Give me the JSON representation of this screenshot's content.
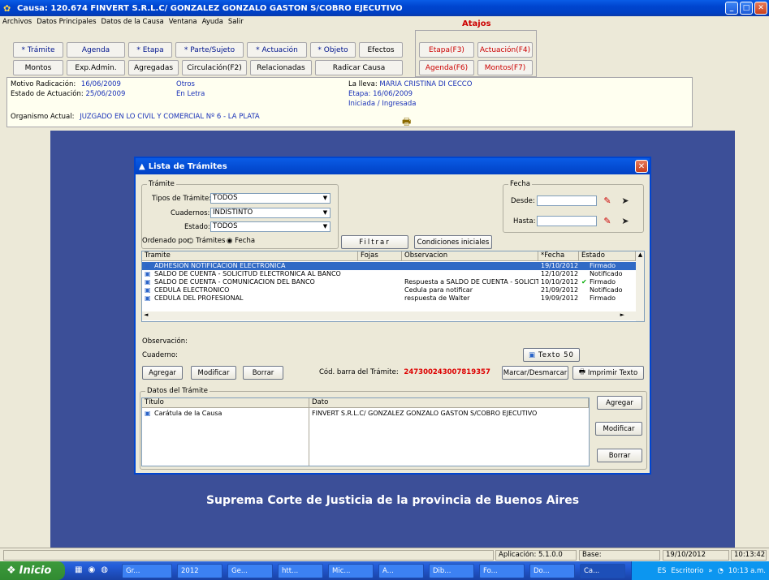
{
  "window": {
    "title": "Causa: 120.674  FINVERT S.R.L.C/ GONZALEZ GONZALO GASTON S/COBRO EJECUTIVO",
    "min": "_",
    "max": "□",
    "close": "✕"
  },
  "menu": [
    "Archivos",
    "Datos Principales",
    "Datos de la Causa",
    "Ventana",
    "Ayuda",
    "Salir"
  ],
  "toolbar": {
    "tramite": "* Trámite",
    "agenda": "Agenda",
    "etapa": "* Etapa",
    "parte": "* Parte/Sujeto",
    "actuacion": "* Actuación",
    "objeto": "* Objeto",
    "efectos": "Efectos",
    "montos": "Montos",
    "expadmin": "Exp.Admin.",
    "agregadas": "Agregadas",
    "circulacion": "Circulación(F2)",
    "relacionadas": "Relacionadas",
    "radicar": "Radicar Causa",
    "atajos_title": "Atajos",
    "etapa_f3": "Etapa(F3)",
    "actuacion_f4": "Actuación(F4)",
    "agenda_f6": "Agenda(F6)",
    "montos_f7": "Montos(F7)"
  },
  "info": {
    "motivo_label": "Motivo Radicación:",
    "motivo_date": "16/06/2009",
    "motivo_value": "Otros",
    "estado_label": "Estado de Actuación:",
    "estado_date": "25/06/2009",
    "estado_value": "En Letra",
    "lleva_label": "La lleva:",
    "lleva_value": "MARIA CRISTINA DI CECCO",
    "etapa": "Etapa: 16/06/2009",
    "iniciada": "Iniciada / Ingresada",
    "organismo_label": "Organismo Actual:",
    "organismo_value": "JUZGADO EN LO CIVIL Y COMERCIAL Nº 6 - LA PLATA"
  },
  "background_caption": "Suprema Corte de Justicia de la provincia de Buenos Aires",
  "dialog": {
    "title": "Lista de Trámites",
    "tramite_group": "Trámite",
    "tipos_label": "Tipos de Trámite:",
    "tipos_value": "TODOS",
    "cuadernos_label": "Cuadernos:",
    "cuadernos_value": "INDISTINTO",
    "estado_label": "Estado:",
    "estado_value": "TODOS",
    "ordenado_label": "Ordenado por:",
    "ord_tramites": "Trámites",
    "ord_fecha": "Fecha",
    "fecha_group": "Fecha",
    "desde_label": "Desde:",
    "hasta_label": "Hasta:",
    "filtrar": "Filtrar",
    "condiciones": "Condiciones iniciales",
    "grid_headers": [
      "Tramite",
      "Fojas",
      "Observacion",
      "*Fecha",
      "Estado"
    ],
    "rows": [
      {
        "tramite": "ADHESION NOTIFICACION ELECTRONICA",
        "fojas": "",
        "obs": "",
        "fecha": "19/10/2012",
        "estado": "Firmado",
        "check": ""
      },
      {
        "tramite": "SALDO DE CUENTA - SOLICITUD ELECTRONICA AL BANCO",
        "fojas": "",
        "obs": "",
        "fecha": "12/10/2012",
        "estado": "Notificado",
        "check": ""
      },
      {
        "tramite": "SALDO DE CUENTA - COMUNICACION DEL BANCO",
        "fojas": "",
        "obs": "Respuesta a SALDO DE CUENTA - SOLICITUD",
        "fecha": "10/10/2012",
        "estado": "Firmado",
        "check": "✔"
      },
      {
        "tramite": "CEDULA ELECTRONICO",
        "fojas": "",
        "obs": "Cedula para notificar",
        "fecha": "21/09/2012",
        "estado": "Notificado",
        "check": ""
      },
      {
        "tramite": "CEDULA DEL PROFESIONAL",
        "fojas": "",
        "obs": "respuesta de Walter",
        "fecha": "19/09/2012",
        "estado": "Firmado",
        "check": ""
      }
    ],
    "observacion_label": "Observación:",
    "cuaderno_label": "Cuaderno:",
    "texto_btn": "Texto 50",
    "agregar": "Agregar",
    "modificar": "Modificar",
    "borrar": "Borrar",
    "cod_barra_label": "Cód. barra del Trámite:",
    "cod_barra_value": "247300243007819357",
    "marcar": "Marcar/Desmarcar",
    "imprimir": "Imprimir Texto",
    "datos_group": "Datos del Trámite",
    "datos_headers": [
      "Título",
      "Dato"
    ],
    "datos_rows": [
      {
        "titulo": "Carátula de la Causa",
        "dato": "FINVERT S.R.L.C/ GONZALEZ GONZALO GASTON S/COBRO EJECUTIVO"
      }
    ],
    "datos_agregar": "Agregar",
    "datos_modificar": "Modificar",
    "datos_borrar": "Borrar"
  },
  "statusbar": {
    "app": "Aplicación: 5.1.0.0",
    "base": "Base:",
    "date": "19/10/2012",
    "time": "10:13:42"
  },
  "taskbar": {
    "start": "Inicio",
    "tasks": [
      "Gr...",
      "2012",
      "Ge...",
      "htt...",
      "Mic...",
      "A...",
      "Dib...",
      "Fo...",
      "Do...",
      "Ca..."
    ],
    "lang": "ES",
    "escritorio": "Escritorio",
    "clock": "10:13 a.m."
  }
}
